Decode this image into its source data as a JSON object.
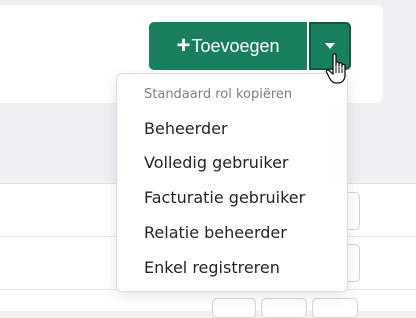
{
  "toolbar": {
    "add_label": "Toevoegen",
    "add_icon": "plus-icon",
    "toggle_icon": "caret-down-icon"
  },
  "dropdown": {
    "header": "Standaard rol kopiëren",
    "items": [
      {
        "label": "Beheerder"
      },
      {
        "label": "Volledig gebruiker"
      },
      {
        "label": "Facturatie gebruiker"
      },
      {
        "label": "Relatie beheerder"
      },
      {
        "label": "Enkel registreren"
      }
    ]
  },
  "colors": {
    "primary": "#1a7f5f",
    "primary_border": "#0f5a42",
    "background": "#eef0f3",
    "text": "#212529",
    "muted": "#7a7f86"
  }
}
